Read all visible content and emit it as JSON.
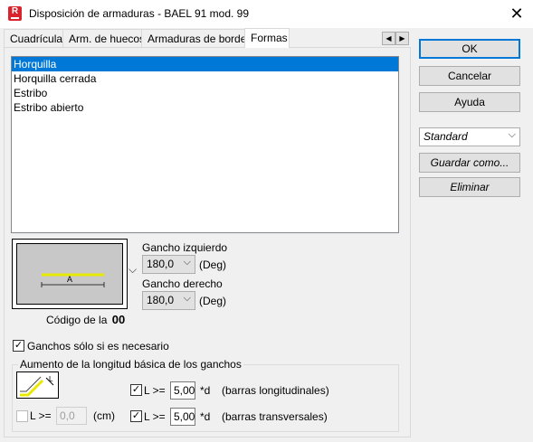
{
  "window": {
    "title": "Disposición de armaduras - BAEL 91 mod. 99",
    "icon_letter": "R",
    "close": "✕"
  },
  "tabs": [
    {
      "label": "Cuadrículas"
    },
    {
      "label": "Arm. de huecos"
    },
    {
      "label": "Armaduras de bordes"
    },
    {
      "label": "Formas"
    }
  ],
  "tab_scroll": {
    "left": "◀",
    "right": "▶"
  },
  "shapes_list": {
    "items": [
      "Horquilla",
      "Horquilla cerrada",
      "Estribo",
      "Estribo abierto"
    ],
    "selected": "Horquilla"
  },
  "preview": {
    "label_a": "A",
    "code_label": "Código de la",
    "code_value": "00",
    "dropdown": "⌵"
  },
  "hooks": {
    "left_label": "Gancho izquierdo",
    "left_value": "180,0",
    "right_label": "Gancho derecho",
    "right_value": "180,0",
    "unit": "(Deg)"
  },
  "only_if_needed": {
    "label": "Ganchos sólo si es necesario",
    "checked": true,
    "mark": "✓"
  },
  "length_group": {
    "title": "Aumento de la longitud básica de los ganchos",
    "l_label": "L >=",
    "l_value": "0,0",
    "l_unit": "(cm)",
    "long_label": "L >=",
    "long_value": "5,00",
    "long_unit": "*d",
    "long_desc": "(barras longitudinales)",
    "trans_label": "L >=",
    "trans_value": "5,00",
    "trans_unit": "*d",
    "trans_desc": "(barras transversales)"
  },
  "buttons": {
    "ok": "OK",
    "cancel": "Cancelar",
    "help": "Ayuda",
    "save_as": "Guardar como...",
    "delete": "Eliminar"
  },
  "standard_combo": {
    "value": "Standard"
  },
  "colors": {
    "accent": "#0078d7",
    "hook_line": "#e8e800",
    "preview_bg": "#c8c8c8",
    "brand": "#d9232d"
  }
}
